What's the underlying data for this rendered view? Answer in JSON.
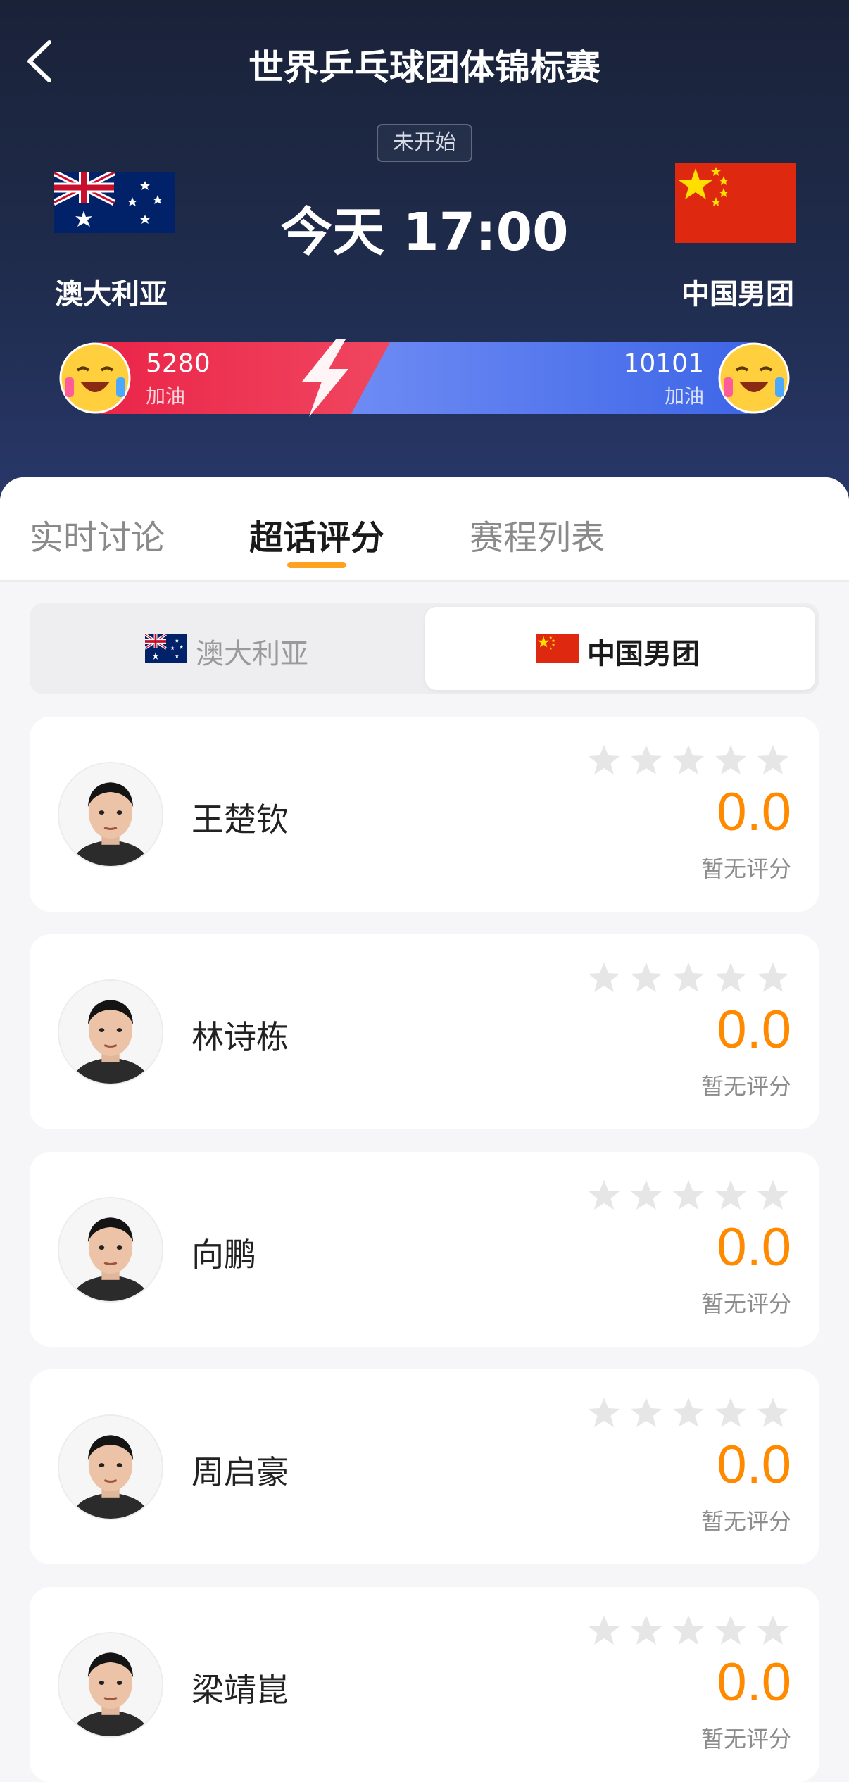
{
  "header": {
    "title": "世界乒乓球团体锦标赛",
    "back_icon": "chevron-left-icon",
    "status": "未开始",
    "time": "今天 17:00"
  },
  "teams": {
    "left": {
      "name": "澳大利亚",
      "flag": "australia-flag"
    },
    "right": {
      "name": "中国男团",
      "flag": "china-flag"
    }
  },
  "support": {
    "left_count": "5280",
    "right_count": "10101",
    "cheer_label": "加油",
    "colors": {
      "left": "#ea2146",
      "right": "#3a63e6"
    }
  },
  "tabs": [
    {
      "label": "实时讨论",
      "active": false
    },
    {
      "label": "超话评分",
      "active": true
    },
    {
      "label": "赛程列表",
      "active": false
    }
  ],
  "team_switch": {
    "left": "澳大利亚",
    "right": "中国男团",
    "selected": "right"
  },
  "players": [
    {
      "name": "王楚钦",
      "score": "0.0",
      "rating_label": "暂无评分",
      "stars_filled": 0
    },
    {
      "name": "林诗栋",
      "score": "0.0",
      "rating_label": "暂无评分",
      "stars_filled": 0
    },
    {
      "name": "向鹏",
      "score": "0.0",
      "rating_label": "暂无评分",
      "stars_filled": 0
    },
    {
      "name": "周启豪",
      "score": "0.0",
      "rating_label": "暂无评分",
      "stars_filled": 0
    },
    {
      "name": "梁靖崑",
      "score": "0.0",
      "rating_label": "暂无评分",
      "stars_filled": 0
    }
  ],
  "accent_color": "#ff8a00"
}
